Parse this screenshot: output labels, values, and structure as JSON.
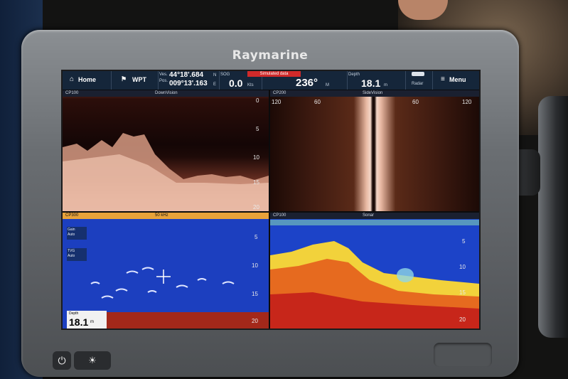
{
  "device": {
    "brand": "Raymarine"
  },
  "topbar": {
    "home_label": "Home",
    "wpt_label": "WPT",
    "ves_label": "Ves.",
    "pos_label": "Pos.",
    "lat": "44°18'.684",
    "lat_hemi": "N",
    "lon": "009°13'.163",
    "lon_hemi": "E",
    "sog_label": "SOG",
    "sog_value": "0.0",
    "sog_unit": "Kts",
    "simulated": "Simulated data",
    "heading_value": "236°",
    "heading_unit": "M",
    "depth_label": "Depth",
    "depth_value": "18.1",
    "depth_unit": "m",
    "radar_label": "Radar",
    "menu_label": "Menu"
  },
  "panes": {
    "downvision": {
      "source": "CP100",
      "title": "DownVision",
      "ticks": [
        "5",
        "10",
        "15",
        "20"
      ]
    },
    "sidevision": {
      "source": "CP200",
      "title": "SideVision",
      "ticks": [
        "120",
        "60",
        "60",
        "120"
      ]
    },
    "fishfinder": {
      "source": "CP300",
      "freq": "50 kHz",
      "gain_label": "Gain",
      "gain_value": "Auto",
      "tvg_label": "TVG",
      "tvg_value": "Auto",
      "depth_label": "Depth",
      "depth_value": "18.1",
      "depth_unit": "m",
      "ticks": [
        "5",
        "10",
        "15",
        "20"
      ]
    },
    "sonar": {
      "source": "CP100",
      "title": "Sonar",
      "ticks": [
        "5",
        "10",
        "15",
        "20"
      ]
    }
  },
  "bottom": {
    "power_icon": "⏻",
    "light_icon": "☀"
  }
}
